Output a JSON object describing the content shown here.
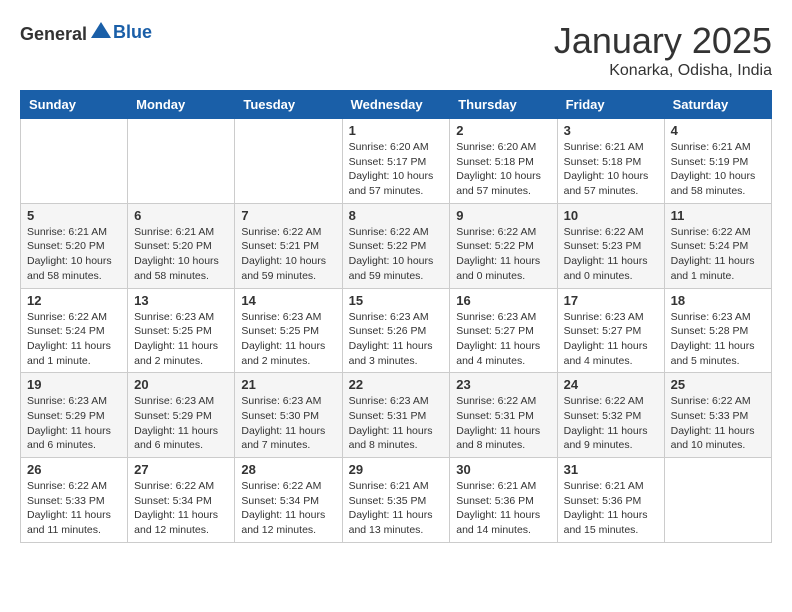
{
  "header": {
    "logo_general": "General",
    "logo_blue": "Blue",
    "month": "January 2025",
    "location": "Konarka, Odisha, India"
  },
  "weekdays": [
    "Sunday",
    "Monday",
    "Tuesday",
    "Wednesday",
    "Thursday",
    "Friday",
    "Saturday"
  ],
  "weeks": [
    [
      {
        "day": "",
        "detail": ""
      },
      {
        "day": "",
        "detail": ""
      },
      {
        "day": "",
        "detail": ""
      },
      {
        "day": "1",
        "detail": "Sunrise: 6:20 AM\nSunset: 5:17 PM\nDaylight: 10 hours\nand 57 minutes."
      },
      {
        "day": "2",
        "detail": "Sunrise: 6:20 AM\nSunset: 5:18 PM\nDaylight: 10 hours\nand 57 minutes."
      },
      {
        "day": "3",
        "detail": "Sunrise: 6:21 AM\nSunset: 5:18 PM\nDaylight: 10 hours\nand 57 minutes."
      },
      {
        "day": "4",
        "detail": "Sunrise: 6:21 AM\nSunset: 5:19 PM\nDaylight: 10 hours\nand 58 minutes."
      }
    ],
    [
      {
        "day": "5",
        "detail": "Sunrise: 6:21 AM\nSunset: 5:20 PM\nDaylight: 10 hours\nand 58 minutes."
      },
      {
        "day": "6",
        "detail": "Sunrise: 6:21 AM\nSunset: 5:20 PM\nDaylight: 10 hours\nand 58 minutes."
      },
      {
        "day": "7",
        "detail": "Sunrise: 6:22 AM\nSunset: 5:21 PM\nDaylight: 10 hours\nand 59 minutes."
      },
      {
        "day": "8",
        "detail": "Sunrise: 6:22 AM\nSunset: 5:22 PM\nDaylight: 10 hours\nand 59 minutes."
      },
      {
        "day": "9",
        "detail": "Sunrise: 6:22 AM\nSunset: 5:22 PM\nDaylight: 11 hours\nand 0 minutes."
      },
      {
        "day": "10",
        "detail": "Sunrise: 6:22 AM\nSunset: 5:23 PM\nDaylight: 11 hours\nand 0 minutes."
      },
      {
        "day": "11",
        "detail": "Sunrise: 6:22 AM\nSunset: 5:24 PM\nDaylight: 11 hours\nand 1 minute."
      }
    ],
    [
      {
        "day": "12",
        "detail": "Sunrise: 6:22 AM\nSunset: 5:24 PM\nDaylight: 11 hours\nand 1 minute."
      },
      {
        "day": "13",
        "detail": "Sunrise: 6:23 AM\nSunset: 5:25 PM\nDaylight: 11 hours\nand 2 minutes."
      },
      {
        "day": "14",
        "detail": "Sunrise: 6:23 AM\nSunset: 5:25 PM\nDaylight: 11 hours\nand 2 minutes."
      },
      {
        "day": "15",
        "detail": "Sunrise: 6:23 AM\nSunset: 5:26 PM\nDaylight: 11 hours\nand 3 minutes."
      },
      {
        "day": "16",
        "detail": "Sunrise: 6:23 AM\nSunset: 5:27 PM\nDaylight: 11 hours\nand 4 minutes."
      },
      {
        "day": "17",
        "detail": "Sunrise: 6:23 AM\nSunset: 5:27 PM\nDaylight: 11 hours\nand 4 minutes."
      },
      {
        "day": "18",
        "detail": "Sunrise: 6:23 AM\nSunset: 5:28 PM\nDaylight: 11 hours\nand 5 minutes."
      }
    ],
    [
      {
        "day": "19",
        "detail": "Sunrise: 6:23 AM\nSunset: 5:29 PM\nDaylight: 11 hours\nand 6 minutes."
      },
      {
        "day": "20",
        "detail": "Sunrise: 6:23 AM\nSunset: 5:29 PM\nDaylight: 11 hours\nand 6 minutes."
      },
      {
        "day": "21",
        "detail": "Sunrise: 6:23 AM\nSunset: 5:30 PM\nDaylight: 11 hours\nand 7 minutes."
      },
      {
        "day": "22",
        "detail": "Sunrise: 6:23 AM\nSunset: 5:31 PM\nDaylight: 11 hours\nand 8 minutes."
      },
      {
        "day": "23",
        "detail": "Sunrise: 6:22 AM\nSunset: 5:31 PM\nDaylight: 11 hours\nand 8 minutes."
      },
      {
        "day": "24",
        "detail": "Sunrise: 6:22 AM\nSunset: 5:32 PM\nDaylight: 11 hours\nand 9 minutes."
      },
      {
        "day": "25",
        "detail": "Sunrise: 6:22 AM\nSunset: 5:33 PM\nDaylight: 11 hours\nand 10 minutes."
      }
    ],
    [
      {
        "day": "26",
        "detail": "Sunrise: 6:22 AM\nSunset: 5:33 PM\nDaylight: 11 hours\nand 11 minutes."
      },
      {
        "day": "27",
        "detail": "Sunrise: 6:22 AM\nSunset: 5:34 PM\nDaylight: 11 hours\nand 12 minutes."
      },
      {
        "day": "28",
        "detail": "Sunrise: 6:22 AM\nSunset: 5:34 PM\nDaylight: 11 hours\nand 12 minutes."
      },
      {
        "day": "29",
        "detail": "Sunrise: 6:21 AM\nSunset: 5:35 PM\nDaylight: 11 hours\nand 13 minutes."
      },
      {
        "day": "30",
        "detail": "Sunrise: 6:21 AM\nSunset: 5:36 PM\nDaylight: 11 hours\nand 14 minutes."
      },
      {
        "day": "31",
        "detail": "Sunrise: 6:21 AM\nSunset: 5:36 PM\nDaylight: 11 hours\nand 15 minutes."
      },
      {
        "day": "",
        "detail": ""
      }
    ]
  ]
}
